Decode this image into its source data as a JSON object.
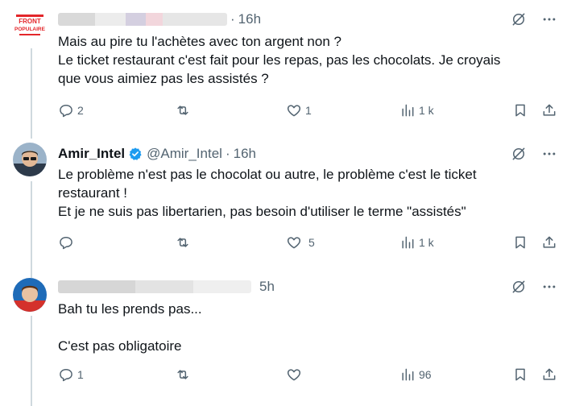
{
  "tweets": [
    {
      "name": "",
      "handle": "",
      "time": "16h",
      "dot": "·",
      "lines": "Mais au pire tu l'achètes avec ton argent non ?\nLe ticket restaurant c'est fait pour les repas, pas les chocolats. Je croyais\nque vous aimiez pas les assistés ?",
      "avatar_text": "FRONT\nPOPULAIRE",
      "replies": "2",
      "retweets": "",
      "likes": "1",
      "views": "1 k"
    },
    {
      "name": "Amir_Intel",
      "handle": "@Amir_Intel",
      "dot": "·",
      "time": "16h",
      "lines": "Le problème n'est pas le chocolat ou autre, le problème c'est le ticket\nrestaurant !\nEt je ne suis pas libertarien, pas besoin d'utiliser le terme \"assistés\"",
      "replies": "",
      "retweets": "",
      "likes": "5",
      "views": "1 k"
    },
    {
      "name": "",
      "handle": "",
      "time": "5h",
      "lines": "Bah tu les prends pas...\n\nC'est pas obligatoire",
      "replies": "1",
      "retweets": "",
      "likes": "",
      "views": "96"
    }
  ],
  "colors": {
    "text": "#0f1419",
    "muted": "#536471",
    "verified": "#1d9bf0",
    "thread_line": "#cfd9de",
    "brand_red": "#e3262a"
  },
  "icons": [
    "reply-icon",
    "retweet-icon",
    "like-icon",
    "views-icon",
    "bookmark-icon",
    "share-icon",
    "grok-icon",
    "more-icon",
    "verified-icon"
  ]
}
